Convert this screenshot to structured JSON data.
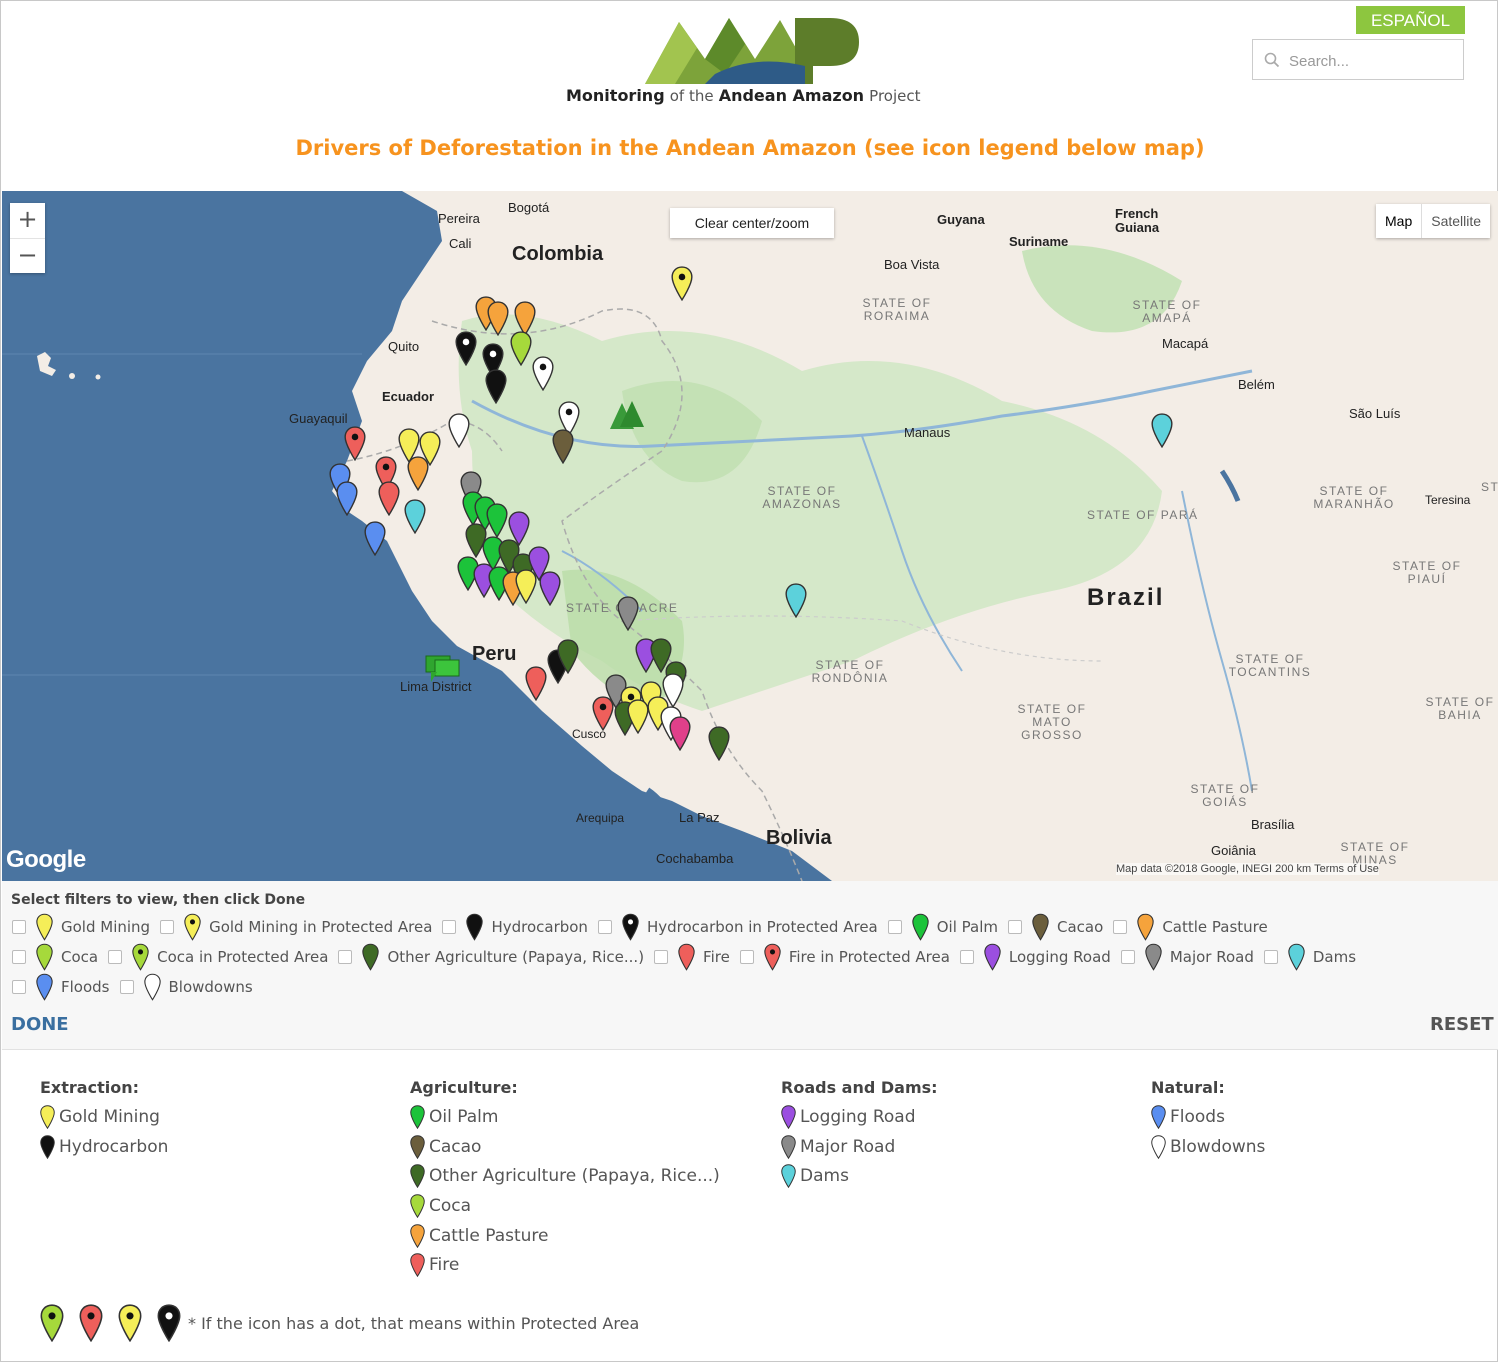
{
  "header": {
    "lang_button": "ESPAÑOL",
    "search_placeholder": "Search...",
    "logo_text": "MAAP",
    "tagline_bold1": "Monitoring",
    "tagline_mid": "of the",
    "tagline_bold2": "Andean Amazon",
    "tagline_end": "Project",
    "title": "Drivers of Deforestation in the Andean Amazon (see icon legend below map)"
  },
  "map": {
    "zoom_in": "+",
    "zoom_out": "−",
    "clear_button": "Clear center/zoom",
    "type_map": "Map",
    "type_satellite": "Satellite",
    "google": "Google",
    "attribution": "Map data ©2018 Google, INEGI    200 km              Terms of Use",
    "countries": {
      "colombia": "Colombia",
      "peru": "Peru",
      "brazil": "Brazil",
      "bolivia": "Bolivia"
    },
    "cities": {
      "pereira": "Pereira",
      "bogota": "Bogotá",
      "cali": "Cali",
      "quito": "Quito",
      "ecuador": "Ecuador",
      "guayaquil": "Guayaquil",
      "guyana": "Guyana",
      "suriname": "Suriname",
      "french_guiana": "French Guiana",
      "boa_vista": "Boa Vista",
      "macapa": "Macapá",
      "belem": "Belém",
      "sao_luis": "São Luís",
      "manaus": "Manaus",
      "teresina": "Teresina",
      "lima": "Lima District",
      "cusco": "Cusco",
      "arequipa": "Arequipa",
      "la_paz": "La Paz",
      "cochabamba": "Cochabamba",
      "brasilia": "Brasília",
      "goiania": "Goiânia"
    },
    "states": {
      "roraima": "STATE OF RORAIMA",
      "amapa": "STATE OF AMAPÁ",
      "amazonas": "STATE OF AMAZONAS",
      "para": "STATE OF PARÁ",
      "maranhao": "STATE OF MARANHÃO",
      "piaui": "STATE OF PIAUÍ",
      "acre": "STATE OF ACRE",
      "rondonia": "STATE OF RONDÔNIA",
      "tocantins": "STATE OF TOCANTINS",
      "bahia": "STATE OF BAHIA",
      "mato_grosso": "STATE OF MATO GROSSO",
      "goias": "STATE OF GOIÁS",
      "minas": "STATE OF MINAS",
      "st": "ST"
    }
  },
  "filters": {
    "heading": "Select filters to view, then click Done",
    "items": [
      {
        "label": "Gold Mining",
        "icon": "pin-yellow",
        "color": "#f5ee58"
      },
      {
        "label": "Gold Mining in Protected Area",
        "icon": "pin-yellow-dot",
        "color": "#f5ee58"
      },
      {
        "label": "Hydrocarbon",
        "icon": "pin-black",
        "color": "#111111"
      },
      {
        "label": "Hydrocarbon in Protected Area",
        "icon": "pin-black-dot",
        "color": "#111111"
      },
      {
        "label": "Oil Palm",
        "icon": "pin-green",
        "color": "#1cc33a"
      },
      {
        "label": "Cacao",
        "icon": "pin-brown",
        "color": "#6b5e3c"
      },
      {
        "label": "Cattle Pasture",
        "icon": "pin-orange",
        "color": "#f5a33c"
      },
      {
        "label": "Coca",
        "icon": "pin-lime",
        "color": "#a6d93b"
      },
      {
        "label": "Coca in Protected Area",
        "icon": "pin-lime-dot",
        "color": "#a6d93b"
      },
      {
        "label": "Other Agriculture (Papaya, Rice...)",
        "icon": "pin-darkgreen",
        "color": "#3e6a25"
      },
      {
        "label": "Fire",
        "icon": "pin-red",
        "color": "#ee5f5b"
      },
      {
        "label": "Fire in Protected Area",
        "icon": "pin-red-dot",
        "color": "#ee5f5b"
      },
      {
        "label": "Logging Road",
        "icon": "pin-purple",
        "color": "#9b4fe0"
      },
      {
        "label": "Major Road",
        "icon": "pin-gray",
        "color": "#8a8a8a"
      },
      {
        "label": "Dams",
        "icon": "pin-cyan",
        "color": "#5cd1db"
      },
      {
        "label": "Floods",
        "icon": "pin-blue",
        "color": "#5a8ef0"
      },
      {
        "label": "Blowdowns",
        "icon": "pin-white",
        "color": "#ffffff"
      }
    ],
    "done": "DONE",
    "reset": "RESET"
  },
  "legend": {
    "extraction": {
      "heading": "Extraction:",
      "items": [
        {
          "label": "Gold Mining",
          "color": "#f5ee58"
        },
        {
          "label": "Hydrocarbon",
          "color": "#111111"
        }
      ]
    },
    "agriculture": {
      "heading": "Agriculture:",
      "items": [
        {
          "label": "Oil Palm",
          "color": "#1cc33a"
        },
        {
          "label": "Cacao",
          "color": "#6b5e3c"
        },
        {
          "label": "Other Agriculture (Papaya, Rice...)",
          "color": "#3e6a25"
        },
        {
          "label": "Coca",
          "color": "#a6d93b"
        },
        {
          "label": "Cattle Pasture",
          "color": "#f5a33c"
        },
        {
          "label": "Fire",
          "color": "#ee5f5b"
        }
      ]
    },
    "roads": {
      "heading": "Roads and Dams:",
      "items": [
        {
          "label": "Logging Road",
          "color": "#9b4fe0"
        },
        {
          "label": "Major Road",
          "color": "#8a8a8a"
        },
        {
          "label": "Dams",
          "color": "#5cd1db"
        }
      ]
    },
    "natural": {
      "heading": "Natural:",
      "items": [
        {
          "label": "Floods",
          "color": "#5a8ef0"
        },
        {
          "label": "Blowdowns",
          "color": "#ffffff"
        }
      ]
    },
    "note": "* If the icon has a dot, that means within Protected Area",
    "note_colors": [
      "#a6d93b",
      "#ee5f5b",
      "#f5ee58",
      "#111111"
    ]
  },
  "markers": [
    {
      "color": "#f5ee58",
      "dot": true,
      "region": "Venezuela border"
    },
    {
      "color": "#f5a33c",
      "dot": false,
      "region": "Colombia"
    },
    {
      "color": "#111111",
      "dot": true,
      "region": "Ecuador"
    },
    {
      "color": "#1cc33a",
      "dot": false,
      "region": "Peru"
    },
    {
      "color": "#9b4fe0",
      "dot": false,
      "region": "Peru"
    },
    {
      "color": "#5cd1db",
      "dot": false,
      "region": "Brazil"
    }
  ]
}
